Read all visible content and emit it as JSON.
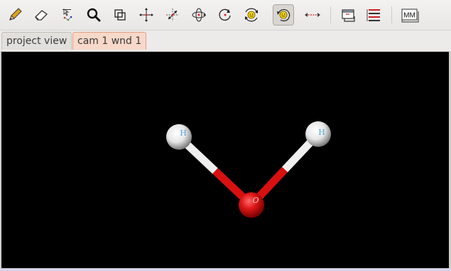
{
  "toolbar": {
    "tools": [
      {
        "icon": "pencil-icon",
        "label": "draw"
      },
      {
        "icon": "eraser-icon",
        "label": "erase"
      },
      {
        "icon": "select-atoms-icon",
        "label": "select"
      },
      {
        "icon": "magnifier-icon",
        "label": "zoom"
      },
      {
        "icon": "clipping-icon",
        "label": "clipping"
      },
      {
        "icon": "translate-xy-icon",
        "label": "translate xy"
      },
      {
        "icon": "translate-z-icon",
        "label": "translate z"
      },
      {
        "icon": "orbit-xy-icon",
        "label": "orbit xy"
      },
      {
        "icon": "orbit-z-icon",
        "label": "orbit z"
      },
      {
        "icon": "rotate-xy-icon",
        "label": "rotate xy"
      },
      {
        "icon": "rotate-z-icon",
        "label": "rotate z"
      },
      {
        "icon": "measure-icon",
        "label": "measure"
      },
      {
        "icon": "build-icon",
        "label": "build"
      },
      {
        "icon": "ribbon-icon",
        "label": "ribbon"
      },
      {
        "icon": "mm-icon",
        "label": "MM"
      }
    ],
    "mm_label": "MM"
  },
  "tabs": [
    {
      "label": "project view",
      "active": false
    },
    {
      "label": "cam 1 wnd 1",
      "active": true
    }
  ],
  "viewport": {
    "atoms": [
      {
        "element": "H",
        "label": "H",
        "color": "#ffffff"
      },
      {
        "element": "H",
        "label": "H",
        "color": "#ffffff"
      },
      {
        "element": "O",
        "label": "O",
        "color": "#e01818"
      }
    ],
    "bond_colors": {
      "hydrogen": "#f2f2f2",
      "oxygen": "#d81010"
    },
    "background": "#000000"
  }
}
